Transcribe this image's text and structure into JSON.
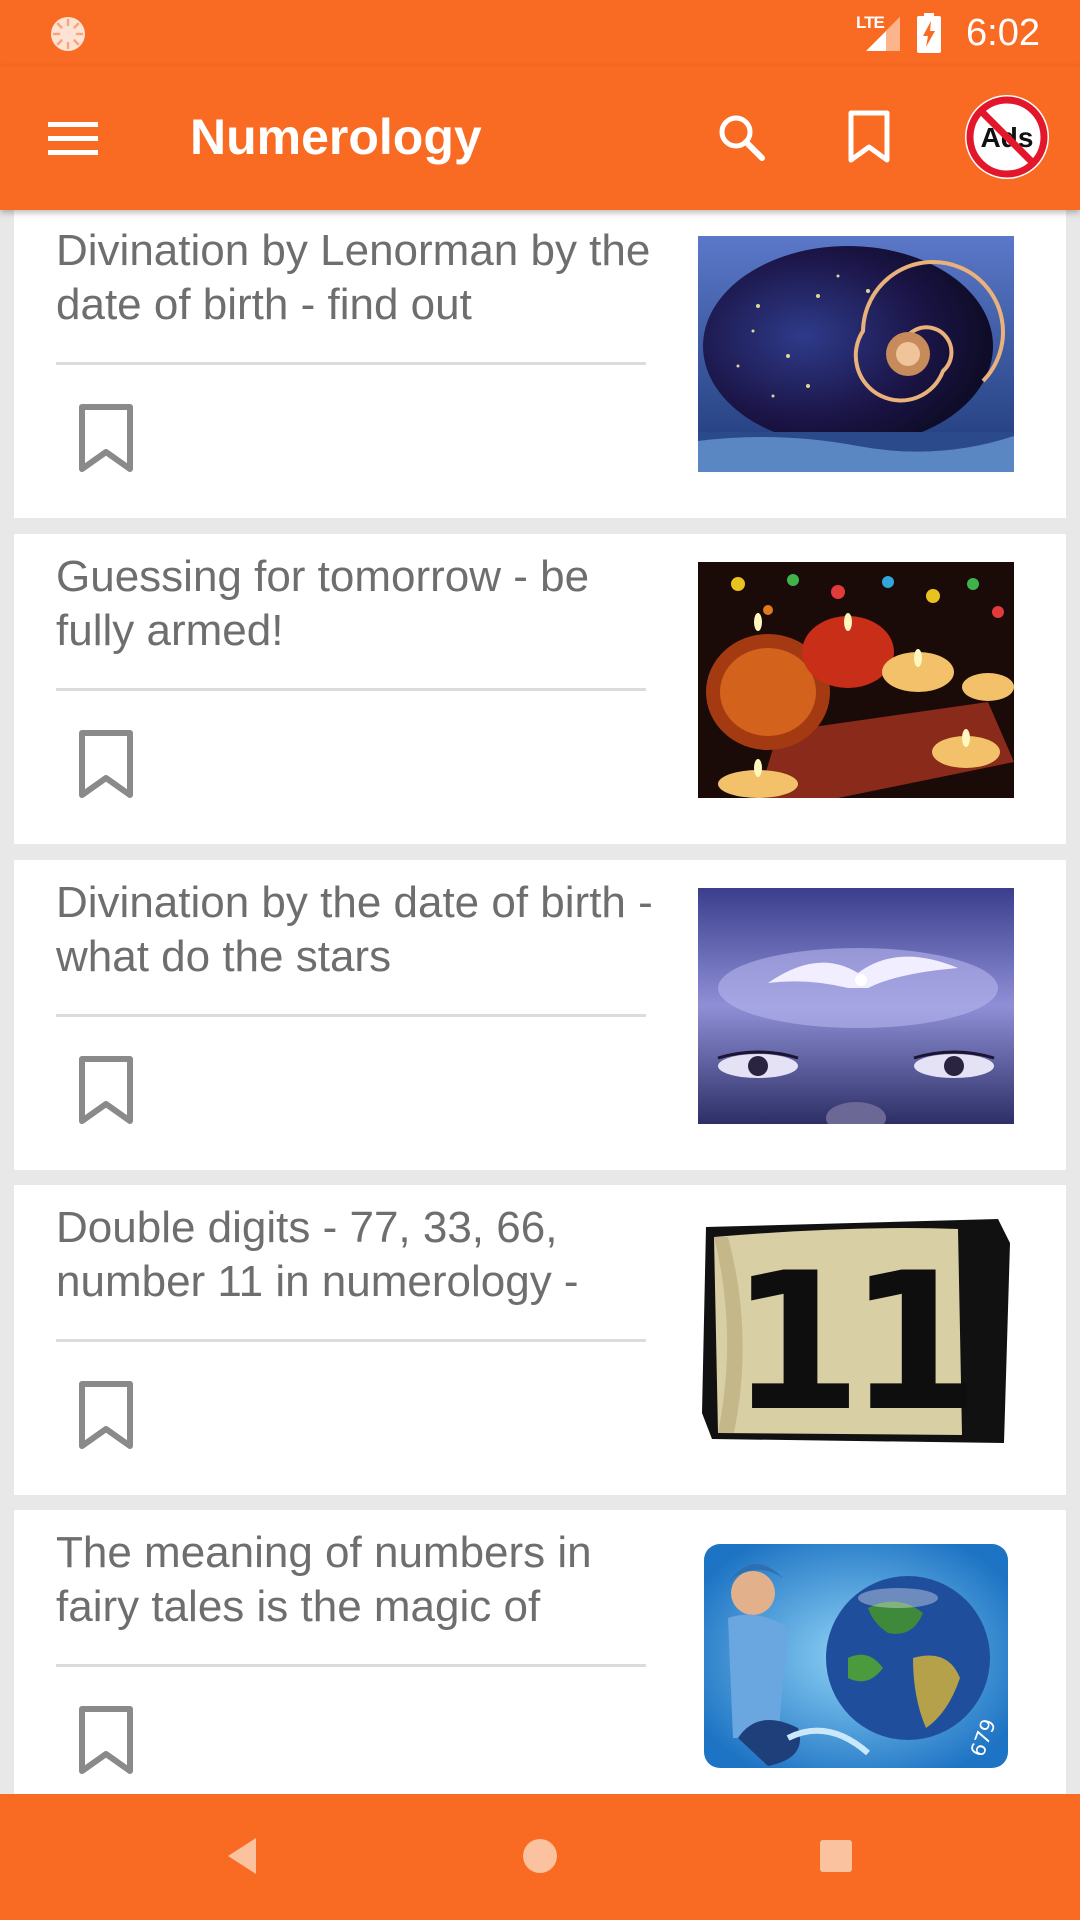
{
  "status_bar": {
    "time": "6:02",
    "network": "LTE",
    "icons": [
      "spinner-icon",
      "signal-icon",
      "battery-charging-icon"
    ]
  },
  "app_bar": {
    "title": "Numerology",
    "icons": [
      "menu-icon",
      "search-icon",
      "bookmark-icon",
      "no-ads-icon"
    ],
    "no_ads_badge": "Ads",
    "background_color": "#F96A22"
  },
  "articles": [
    {
      "title": "Divination by Lenorman by the date of birth - find out",
      "image": "cosmic-nautilus-shell",
      "bookmarked": false
    },
    {
      "title": "Guessing for tomorrow - be fully armed!",
      "image": "candles-and-cards",
      "bookmarked": false
    },
    {
      "title": "Divination by the date of birth - what do the stars",
      "image": "eyes-and-dove",
      "bookmarked": false
    },
    {
      "title": "Double digits - 77, 33, 66, number 11 in numerology -",
      "image": "number-eleven-plate",
      "bookmarked": false,
      "image_text": "11"
    },
    {
      "title": "The meaning of numbers in fairy tales is the magic of",
      "image": "earth-and-fairy",
      "bookmarked": false,
      "image_text": "679"
    }
  ],
  "nav_bar": {
    "icons": [
      "back-icon",
      "home-icon",
      "recents-icon"
    ]
  },
  "colors": {
    "accent": "#F96A22",
    "card_text": "#6E6E6E",
    "list_background": "#E8E8E8"
  }
}
